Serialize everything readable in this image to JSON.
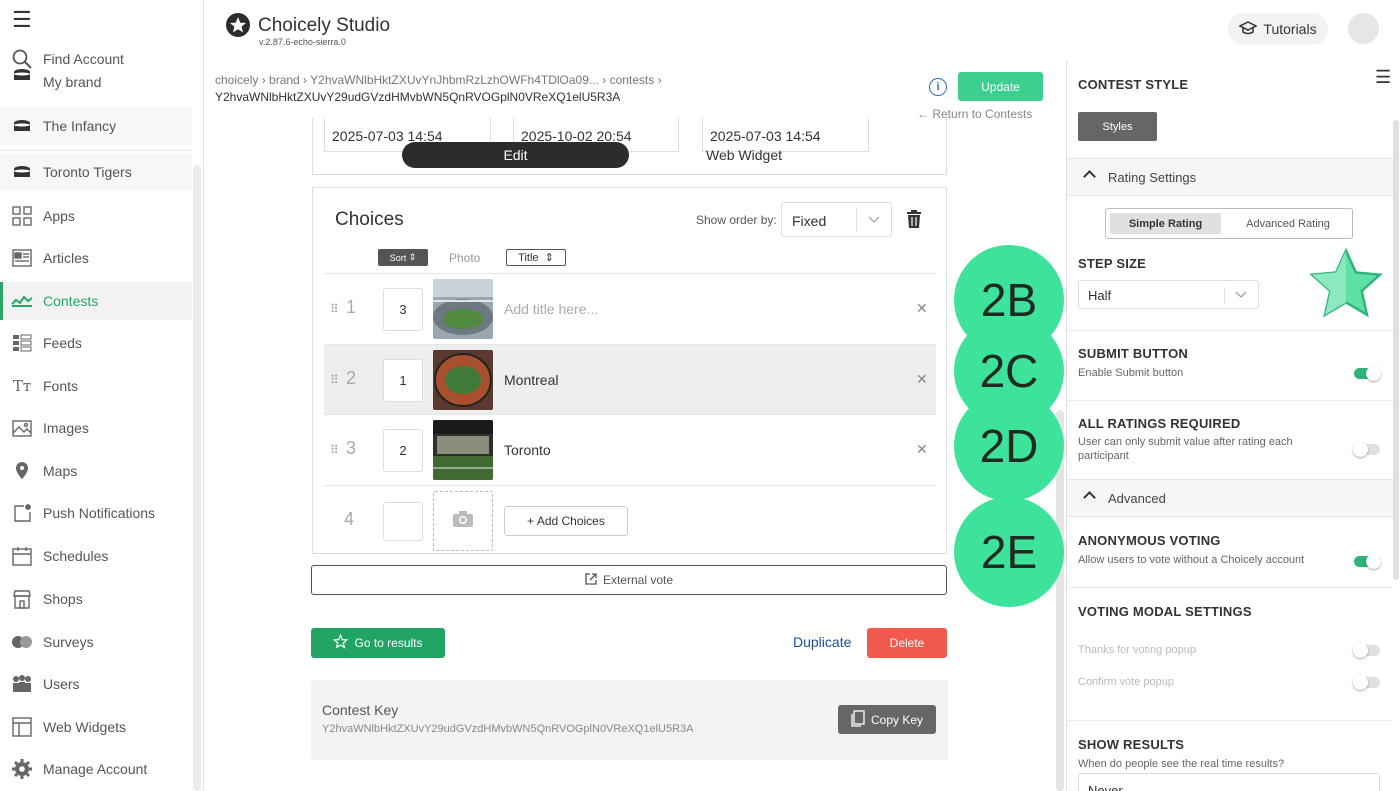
{
  "sidebar": {
    "items": [
      {
        "label": "Find Account",
        "icon": "search-icon"
      },
      {
        "label": "My brand",
        "icon": "brand-icon"
      },
      {
        "label": "The Infancy",
        "icon": "brand-icon"
      },
      {
        "label": "Toronto Tigers",
        "icon": "brand-icon"
      },
      {
        "label": "Apps",
        "icon": "apps-icon"
      },
      {
        "label": "Articles",
        "icon": "articles-icon"
      },
      {
        "label": "Contests",
        "icon": "contests-icon"
      },
      {
        "label": "Feeds",
        "icon": "feeds-icon"
      },
      {
        "label": "Fonts",
        "icon": "fonts-icon"
      },
      {
        "label": "Images",
        "icon": "images-icon"
      },
      {
        "label": "Maps",
        "icon": "maps-icon"
      },
      {
        "label": "Push Notifications",
        "icon": "push-icon"
      },
      {
        "label": "Schedules",
        "icon": "schedules-icon"
      },
      {
        "label": "Shops",
        "icon": "shops-icon"
      },
      {
        "label": "Surveys",
        "icon": "surveys-icon"
      },
      {
        "label": "Users",
        "icon": "users-icon"
      },
      {
        "label": "Web Widgets",
        "icon": "widgets-icon"
      },
      {
        "label": "Manage Account",
        "icon": "gear-icon"
      }
    ],
    "active": "Contests"
  },
  "header": {
    "app_name": "Choicely Studio",
    "version": "v.2.87.6-echo-sierra.0",
    "tutorials_label": "Tutorials"
  },
  "breadcrumb": {
    "line1": "choicely › brand › Y2hvaWNlbHktZXUvYnJhbmRzLzhOWFh4TDlOa09... › contests ›",
    "line2": "Y2hvaWNlbHktZXUvY29udGVzdHMvbWN5QnRVOGplN0VReXQ1elU5R3A"
  },
  "actions": {
    "update_label": "Update",
    "return_label": "Return to Contests"
  },
  "dates": [
    "2025-07-03 14:54",
    "2025-10-02 20:54",
    "2025-07-03 14:54"
  ],
  "tabs": {
    "edit": "Edit",
    "web_widget": "Web Widget"
  },
  "choices": {
    "title": "Choices",
    "show_order_label": "Show order by:",
    "order_value": "Fixed",
    "col_sort": "Sort",
    "col_photo": "Photo",
    "col_title": "Title",
    "rows": [
      {
        "num": "1",
        "sort": "3",
        "title": "",
        "placeholder": "Add title here..."
      },
      {
        "num": "2",
        "sort": "1",
        "title": "Montreal"
      },
      {
        "num": "3",
        "sort": "2",
        "title": "Toronto"
      },
      {
        "num": "4"
      }
    ],
    "add_label": "+ Add Choices"
  },
  "external_vote_label": "External vote",
  "go_results_label": "Go to results",
  "duplicate_label": "Duplicate",
  "delete_label": "Delete",
  "contest_key": {
    "title": "Contest Key",
    "value": "Y2hvaWNlbHktZXUvY29udGVzdHMvbWN5QnRVOGplN0VReXQ1elU5R3A",
    "copy_label": "Copy Key"
  },
  "badges": [
    "2B",
    "2C",
    "2D",
    "2E"
  ],
  "right_panel": {
    "contest_style": "CONTEST STYLE",
    "styles_btn": "Styles",
    "rating_settings": "Rating Settings",
    "simple_rating": "Simple Rating",
    "advanced_rating": "Advanced Rating",
    "step_size": "STEP SIZE",
    "step_value": "Half",
    "submit_button": "SUBMIT BUTTON",
    "submit_sub": "Enable Submit button",
    "all_ratings": "ALL RATINGS REQUIRED",
    "all_ratings_sub": "User can only submit value after rating each participant",
    "advanced": "Advanced",
    "anon": "ANONYMOUS VOTING",
    "anon_sub": "Allow users to vote without a Choicely account",
    "modal": "VOTING MODAL SETTINGS",
    "thanks": "Thanks for voting popup",
    "confirm": "Confirm vote popup",
    "show_results": "SHOW RESULTS",
    "show_results_sub": "When do people see the real time results?",
    "results_value": "Never",
    "toggles": {
      "submit": true,
      "all_ratings": false,
      "anon": true,
      "thanks": false,
      "confirm": false
    }
  },
  "colors": {
    "accent": "#2aa46a",
    "badge": "#3de39a",
    "update": "#3ccf8e",
    "delete": "#f25a4e",
    "go": "#21a463"
  }
}
